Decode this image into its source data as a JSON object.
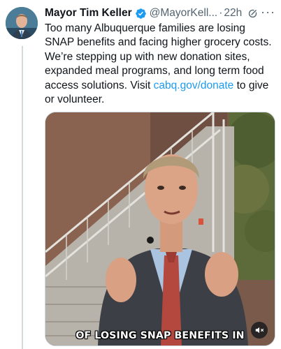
{
  "tweet": {
    "author_name": "Mayor Tim Keller",
    "handle": "@MayorKell...",
    "separator": "·",
    "time": "22h",
    "more_label": "···",
    "text_before_link": "Too many Albuquerque families are losing SNAP benefits and facing higher grocery costs. We’re stepping up with new donation sites, expanded meal programs, and long term food access solutions. Visit ",
    "link_text": "cabq.gov/donate",
    "text_after_link": " to give or volunteer."
  },
  "video": {
    "caption": "OF LOSING SNAP BENEFITS IN"
  },
  "colors": {
    "link": "#1d9bf0",
    "verified_badge": "#1d9bf0",
    "secondary_text": "#536471"
  },
  "icons": {
    "verified": "verified-badge-icon",
    "grok": "grok-icon",
    "more": "more-options-icon",
    "mute": "speaker-muted-icon"
  }
}
